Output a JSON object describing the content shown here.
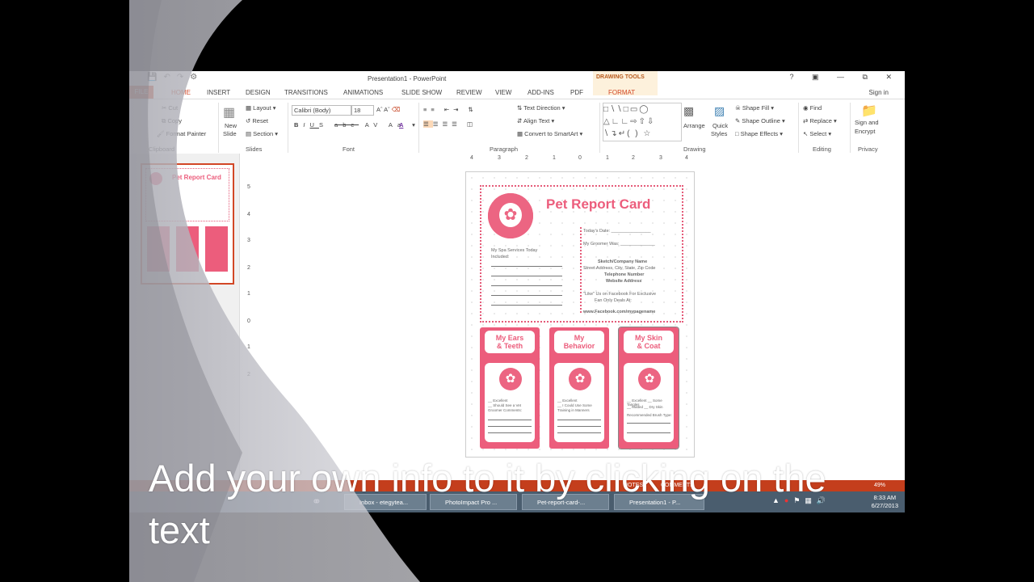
{
  "window": {
    "title": "Presentation1 - PowerPoint",
    "context_tab_group": "DRAWING TOOLS",
    "signin": "Sign in",
    "help": "?"
  },
  "tabs": [
    "FILE",
    "HOME",
    "INSERT",
    "DESIGN",
    "TRANSITIONS",
    "ANIMATIONS",
    "SLIDE SHOW",
    "REVIEW",
    "VIEW",
    "ADD-INS",
    "PDF",
    "FORMAT"
  ],
  "ribbon": {
    "clipboard": {
      "cut": "Cut",
      "copy": "Copy",
      "format_painter": "Format Painter",
      "group": "Clipboard"
    },
    "slides": {
      "new_slide_1": "New",
      "new_slide_2": "Slide",
      "layout": "Layout",
      "reset": "Reset",
      "section": "Section",
      "group": "Slides"
    },
    "font": {
      "name": "Calibri (Body)",
      "size": "18",
      "group": "Font"
    },
    "paragraph": {
      "text_direction": "Text Direction",
      "align_text": "Align Text",
      "convert": "Convert to SmartArt",
      "group": "Paragraph"
    },
    "drawing": {
      "arrange": "Arrange",
      "quick_styles_1": "Quick",
      "quick_styles_2": "Styles",
      "shape_fill": "Shape Fill",
      "shape_outline": "Shape Outline",
      "shape_effects": "Shape Effects",
      "group": "Drawing"
    },
    "editing": {
      "find": "Find",
      "replace": "Replace",
      "select": "Select",
      "group": "Editing"
    },
    "privacy": {
      "sign_encrypt_1": "Sign and",
      "sign_encrypt_2": "Encrypt",
      "group": "Privacy"
    }
  },
  "ruler": {
    "h": [
      "4",
      "3",
      "2",
      "1",
      "0",
      "1",
      "2",
      "3",
      "4"
    ],
    "v": [
      "5",
      "4",
      "3",
      "2",
      "1",
      "0",
      "1",
      "2"
    ]
  },
  "thumbnail": {
    "title": "Pet Report Card"
  },
  "slide": {
    "title": "Pet Report Card",
    "todays_date": "Today's Date: ________________",
    "my_groomer": "My Groomer Was: ______________",
    "spa_services": "My     Spa     Services     Today",
    "included": "Included:",
    "company": "Sketch/Company Name",
    "address": "Street Address, City, State, Zip Code",
    "phone": "Telephone Number",
    "website": "Website Address",
    "like_us": "\"Like\" Us on Facebook For Exclusive",
    "fan_deals": "Fan Only Deals At:",
    "facebook_url": "www.Facebook.com/mypagename",
    "cards": [
      {
        "label_1": "My Ears",
        "label_2": "& Teeth",
        "opt_1": "__ Excellent",
        "opt_2": "__ Should See a Vet",
        "opt_3": "Groomer Comments:"
      },
      {
        "label_1": "My",
        "label_2": "Behavior",
        "opt_1": "__ Excellent",
        "opt_2": "__ I Could Use Some",
        "opt_3": "Training in Manners"
      },
      {
        "label_1": "My Skin",
        "label_2": "& Coat",
        "opt_1": "__ Excellent  __ Some Tangles",
        "opt_2": "__ Matted  __ Dry Skin",
        "opt_3": "Recommended Brush Type:"
      }
    ]
  },
  "statusbar": {
    "notes": "NOTES",
    "comments": "COMMENTS",
    "zoom": "49%"
  },
  "taskbar": {
    "items": [
      "Inbox - etegytea...",
      "PhotoImpact Pro ...",
      "Pet-report-card-...",
      "Presentation1 - P..."
    ],
    "time": "8:33 AM",
    "date": "6/27/2013"
  },
  "caption": "Add your own info to it by clicking on the text"
}
